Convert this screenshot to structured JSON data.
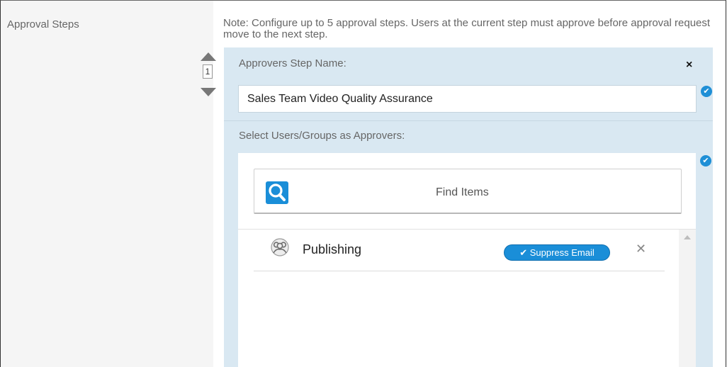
{
  "section": {
    "label": "Approval Steps",
    "note": "Note: Configure up to 5 approval steps. Users at the current step must approve before approval request move to the next step."
  },
  "stepper": {
    "step_number": "1"
  },
  "step": {
    "name_label": "Approvers Step Name:",
    "close_glyph": "×",
    "name_value": "Sales Team Video Quality Assurance",
    "valid_glyph": "✔",
    "approvers_label": "Select Users/Groups as Approvers:"
  },
  "finder": {
    "label": "Find Items"
  },
  "approvers": [
    {
      "name": "Publishing",
      "icon": "group-icon",
      "badge": "✔ Suppress Email",
      "remove_glyph": "✕"
    }
  ],
  "colors": {
    "accent": "#1a8ed8",
    "panel_bg": "#d9e8f2",
    "sidebar_bg": "#f5f5f5"
  }
}
